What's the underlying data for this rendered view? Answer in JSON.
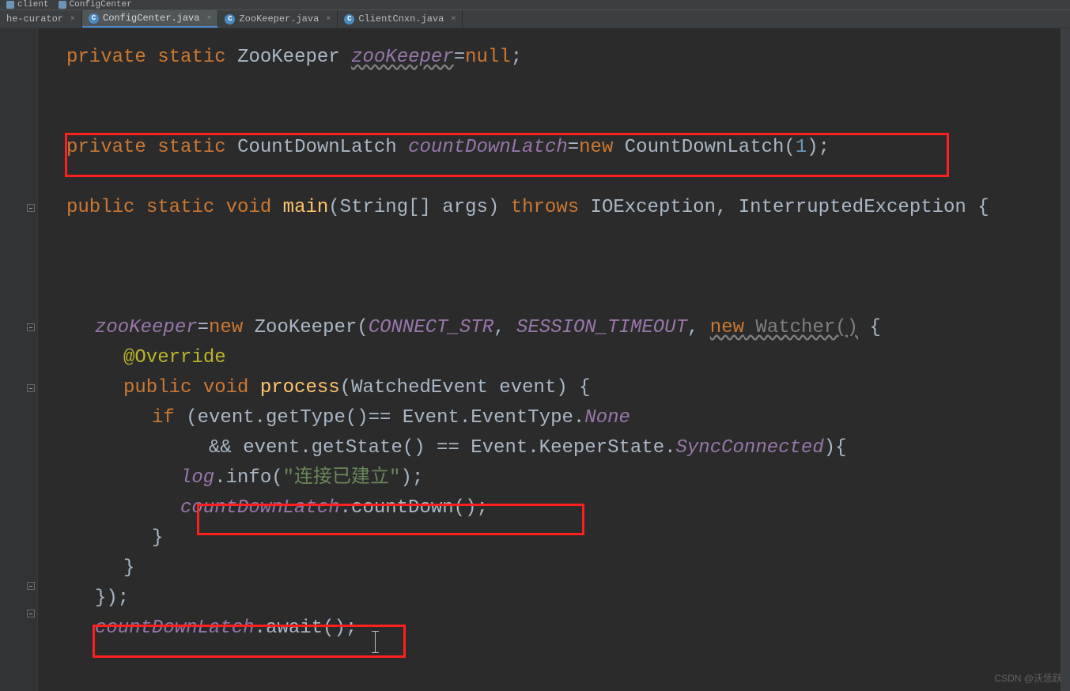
{
  "breadcrumb": {
    "client": "client",
    "config": "ConfigCenter"
  },
  "tabs": {
    "curator": "he-curator",
    "config": "ConfigCenter.java",
    "zoo": "ZooKeeper.java",
    "cnxn": "ClientCnxn.java",
    "close": "×"
  },
  "code": {
    "private": "private",
    "static": "static",
    "public": "public",
    "void": "void",
    "new": "new",
    "throws": "throws",
    "if": "if",
    "null": "null",
    "ZooKeeper": "ZooKeeper",
    "zooKeeper_fld": "zooKeeper",
    "eqnull": "=null;",
    "CountDownLatch": "CountDownLatch",
    "countDownLatch_fld": "countDownLatch",
    "eqnew": "=new ",
    "one": "1",
    "main": "main",
    "main_args": "(String[] args) ",
    "IOException": "IOException, InterruptedException {",
    "zk_assign": "=",
    "zk_new": " ZooKeeper(",
    "CONNECT_STR": "CONNECT_STR",
    "comma": ", ",
    "SESSION_TIMEOUT": "SESSION_TIMEOUT",
    "new_watcher": "new Watcher()",
    "brace_open": " {",
    "Override": "@Override",
    "process": "process",
    "process_args": "(WatchedEvent event) {",
    "if_cond1": " (event.getType()== Event.EventType.",
    "None": "None",
    "and": "&& event.getState() == Event.KeeperState.",
    "SyncConnected": "SyncConnected",
    "close_paren_brace": "){",
    "log": "log",
    "info": ".info(",
    "str_conn": "\"连接已建立\"",
    "close_info": ");",
    "countDown": ".countDown();",
    "brace_close": "}",
    "end_anon": "});",
    "await": ".await();"
  },
  "watermark": "CSDN @沃恁跃"
}
